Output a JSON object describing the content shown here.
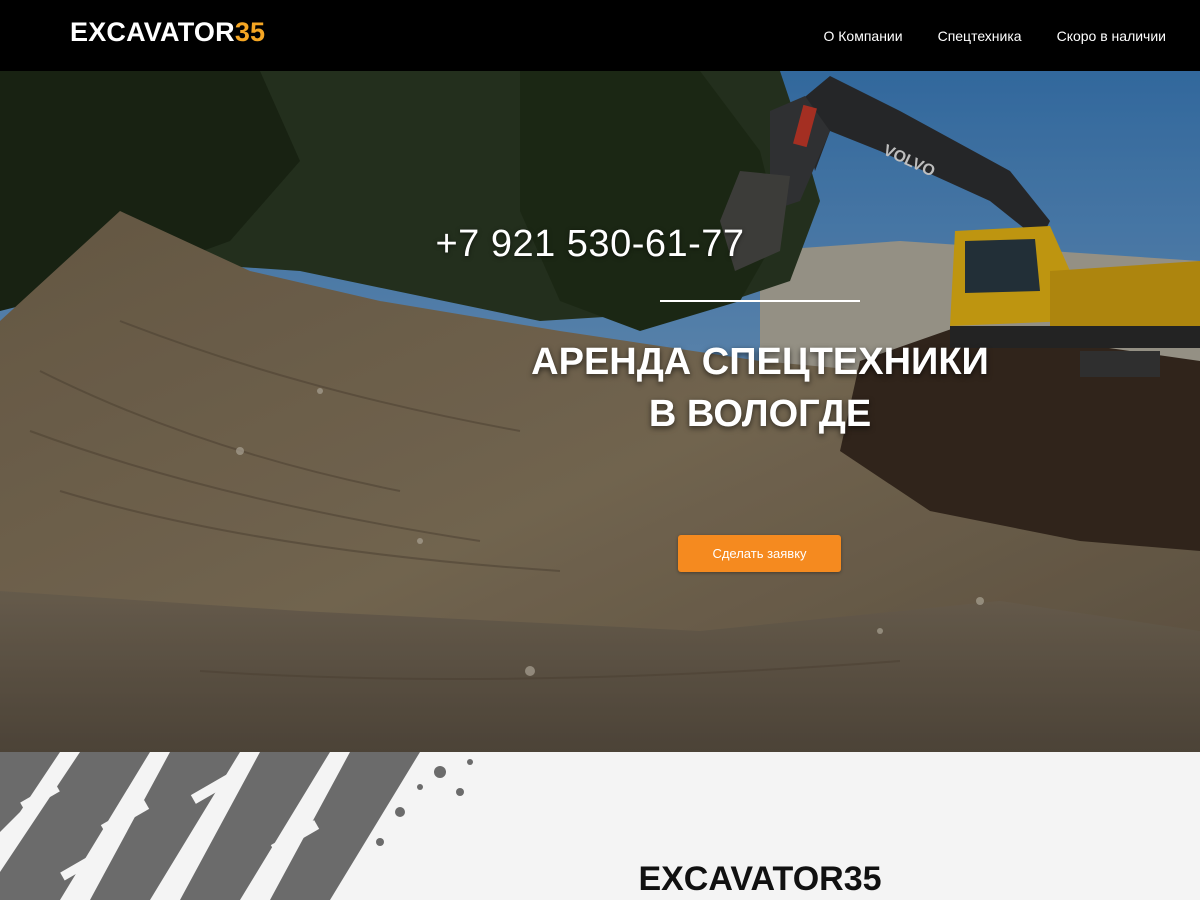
{
  "header": {
    "logo_main": "EXCAVATOR",
    "logo_accent": "35",
    "nav": [
      {
        "label": "О Компании"
      },
      {
        "label": "Спецтехника"
      },
      {
        "label": "Скоро в наличии"
      }
    ]
  },
  "hero": {
    "phone": "+7 921 530-61-77",
    "title_line1": "АРЕНДА СПЕЦТЕХНИКИ",
    "title_line2": "В ВОЛОГДЕ",
    "cta_label": "Сделать заявку",
    "excavator_brand": "VOLVO"
  },
  "lower": {
    "title": "EXCAVATOR35"
  },
  "colors": {
    "header_bg": "#000000",
    "accent": "#f5a623",
    "cta": "#f58a1f",
    "excavator_yellow": "#e8b614"
  }
}
